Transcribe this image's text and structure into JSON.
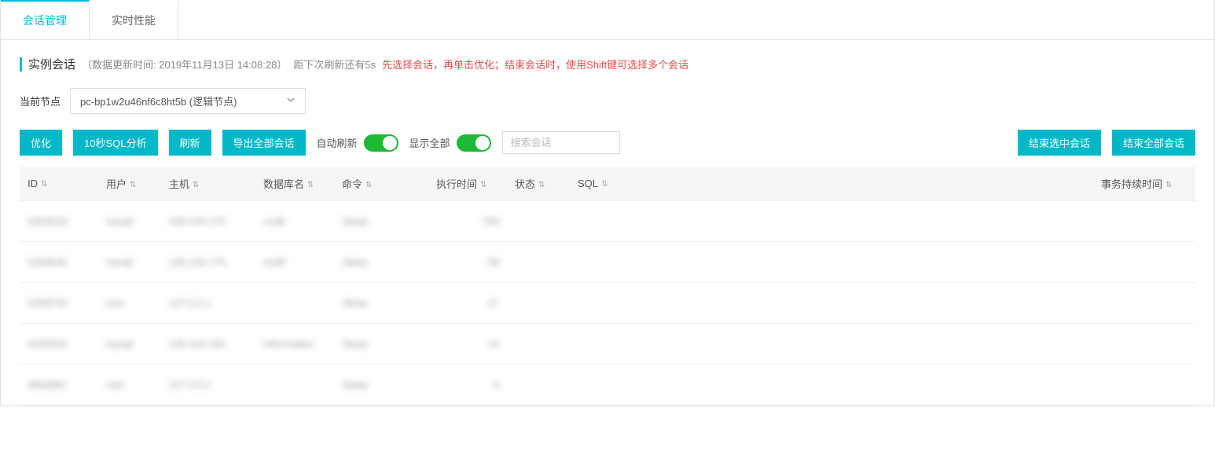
{
  "tabs": {
    "session": "会话管理",
    "realtime": "实时性能"
  },
  "header": {
    "title": "实例会话",
    "update_meta": "（数据更新时间: 2019年11月13日 14:08:28）",
    "countdown": "距下次刷新还有5s",
    "hint": "先选择会话，再单击优化；结束会话时，使用Shift键可选择多个会话"
  },
  "node": {
    "label": "当前节点",
    "selected": "pc-bp1w2u46nf6c8ht5b (逻辑节点)"
  },
  "toolbar": {
    "optimize": "优化",
    "ten_sec_sql": "10秒SQL分析",
    "refresh": "刷新",
    "export_all": "导出全部会话",
    "auto_refresh": "自动刷新",
    "show_all": "显示全部",
    "search_placeholder": "搜索会话",
    "end_selected": "结束选中会话",
    "end_all": "结束全部会话"
  },
  "columns": {
    "id": "ID",
    "user": "用户",
    "host": "主机",
    "db": "数据库名",
    "cmd": "命令",
    "exec_time": "执行时间",
    "state": "状态",
    "sql": "SQL",
    "tx_duration": "事务持续时间"
  },
  "rows": [
    {
      "id": "5293020",
      "user": "mysql",
      "host": "100.104.175.",
      "db": "cndlt",
      "cmd": "Sleep",
      "exec_time": "793",
      "state": "",
      "sql": "",
      "tx": ""
    },
    {
      "id": "5293045",
      "user": "mysql",
      "host": "100.104.175.",
      "db": "cndlt",
      "cmd": "Sleep",
      "exec_time": "58",
      "state": "",
      "sql": "",
      "tx": ""
    },
    {
      "id": "5289732",
      "user": "root",
      "host": "127.0.0.1",
      "db": "",
      "cmd": "Sleep",
      "exec_time": "27",
      "state": "",
      "sql": "",
      "tx": ""
    },
    {
      "id": "5293020",
      "user": "mysql",
      "host": "100.104.202.",
      "db": "information",
      "cmd": "Sleep",
      "exec_time": "14",
      "state": "",
      "sql": "",
      "tx": ""
    },
    {
      "id": "4863891",
      "user": "root",
      "host": "127.0.0.1",
      "db": "",
      "cmd": "Sleep",
      "exec_time": "8",
      "state": "",
      "sql": "",
      "tx": ""
    }
  ]
}
